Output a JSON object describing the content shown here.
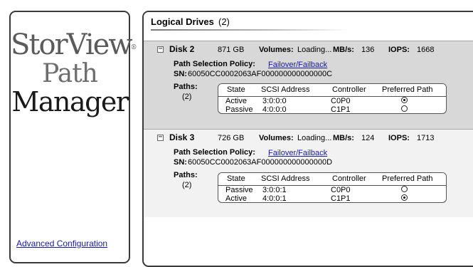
{
  "sidebar": {
    "logo": {
      "line1": "StorView",
      "mark": "®",
      "line2": "Path",
      "line3": "Manager"
    },
    "advanced_link": "Advanced Configuration"
  },
  "main": {
    "title": "Logical Drives",
    "count": "(2)",
    "disks": [
      {
        "name": "Disk 2",
        "size": "871 GB",
        "volumes_label": "Volumes:",
        "volumes_value": "Loading...",
        "mbs_label": "MB/s:",
        "mbs_value": "136",
        "iops_label": "IOPS:",
        "iops_value": "1668",
        "policy_label": "Path Selection Policy:",
        "policy_value": "Failover/Failback",
        "sn_label": "SN:",
        "sn_value": "60050CC0002063AF000000000000000C",
        "paths_label": "Paths:",
        "paths_count": "(2)",
        "headers": [
          "State",
          "SCSI Address",
          "Controller",
          "Preferred Path"
        ],
        "rows": [
          {
            "state": "Active",
            "address": "3:0:0:0",
            "controller": "C0P0",
            "preferred": true
          },
          {
            "state": "Passive",
            "address": "4:0:0:0",
            "controller": "C1P1",
            "preferred": false
          }
        ]
      },
      {
        "name": "Disk 3",
        "size": "726 GB",
        "volumes_label": "Volumes:",
        "volumes_value": "Loading...",
        "mbs_label": "MB/s:",
        "mbs_value": "124",
        "iops_label": "IOPS:",
        "iops_value": "1713",
        "policy_label": "Path Selection Policy:",
        "policy_value": "Failover/Failback",
        "sn_label": "SN:",
        "sn_value": "60050CC0002063AF000000000000000D",
        "paths_label": "Paths:",
        "paths_count": "(2)",
        "headers": [
          "State",
          "SCSI Address",
          "Controller",
          "Preferred Path"
        ],
        "rows": [
          {
            "state": "Passive",
            "address": "3:0:0:1",
            "controller": "C0P0",
            "preferred": false
          },
          {
            "state": "Active",
            "address": "4:0:0:1",
            "controller": "C1P1",
            "preferred": true
          }
        ]
      }
    ]
  }
}
